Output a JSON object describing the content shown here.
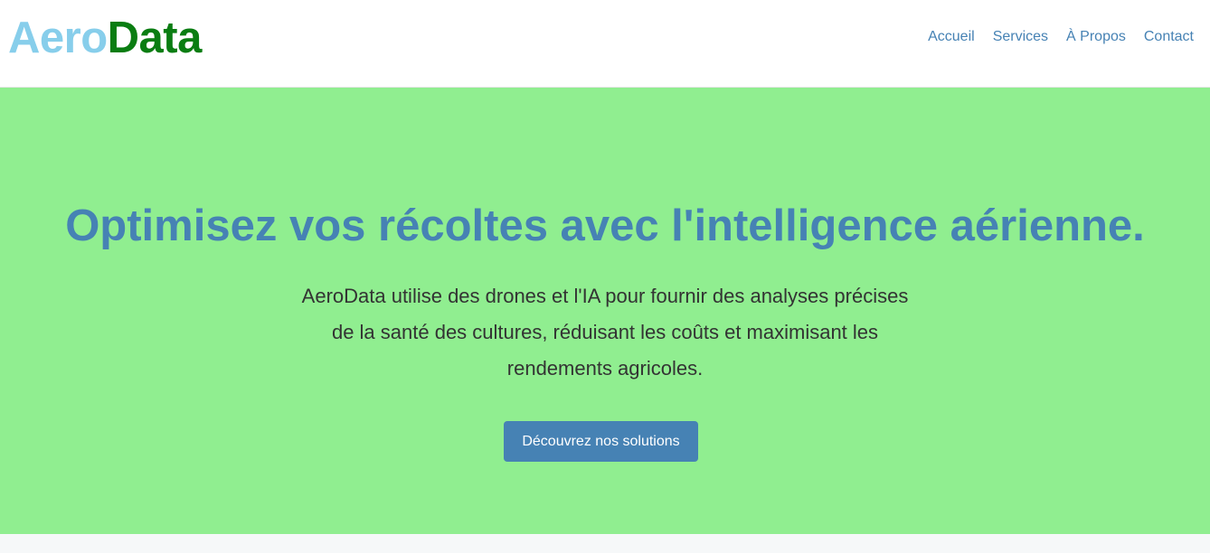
{
  "header": {
    "logo": {
      "part1": "Aero",
      "part2": "Data",
      "part1_color": "#87ceeb",
      "part2_color": "#0a7d12"
    },
    "nav": [
      {
        "label": "Accueil"
      },
      {
        "label": "Services"
      },
      {
        "label": "À Propos"
      },
      {
        "label": "Contact"
      }
    ],
    "nav_color": "#4682b4"
  },
  "hero": {
    "title": "Optimisez vos récoltes avec l'intelligence aérienne.",
    "description": "AeroData utilise des drones et l'IA pour fournir des analyses précises de la santé des cultures, réduisant les coûts et maximisant les rendements agricoles.",
    "cta_label": "Découvrez nos solutions",
    "background_color": "#90ee90",
    "title_color": "#4682b4",
    "button_color": "#4682b4"
  }
}
